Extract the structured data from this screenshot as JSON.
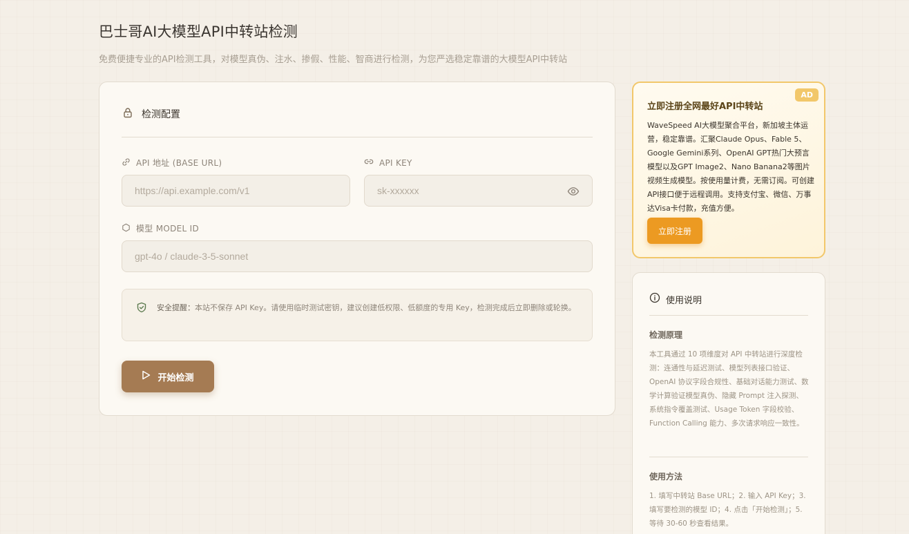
{
  "header": {
    "title": "巴士哥AI大模型API中转站检测",
    "subtitle": "免费便捷专业的API检测工具，对模型真伪、注水、掺假、性能、智商进行检测，为您严选稳定靠谱的大模型API中转站"
  },
  "config": {
    "title": "检测配置",
    "base_url_label": "API 地址 (BASE URL)",
    "base_url_placeholder": "https://api.example.com/v1",
    "api_key_label": "API KEY",
    "api_key_placeholder": "sk-xxxxxx",
    "model_label": "模型 MODEL ID",
    "model_placeholder": "gpt-4o / claude-3-5-sonnet",
    "notice_prefix": "安全提醒：",
    "notice_text": "本站不保存 API Key。请使用临时测试密钥，建议创建低权限、低额度的专用 Key，检测完成后立即删除或轮换。",
    "start_button": "开始检测"
  },
  "ad": {
    "badge": "AD",
    "title": "立即注册全网最好API中转站",
    "description": "WaveSpeed AI大模型聚合平台，新加坡主体运营，稳定靠谱。汇聚Claude Opus、Fable 5、Google Gemini系列、OpenAI GPT热门大预言模型以及GPT Image2、Nano Banana2等图片视频生成模型。按使用量计费，无需订阅。可创建API接口便于远程调用。支持支付宝、微信、万事达Visa卡付款，充值方便。",
    "button": "立即注册"
  },
  "help": {
    "title": "使用说明",
    "principle_title": "检测原理",
    "principle_text": "本工具通过 10 项维度对 API 中转站进行深度检测：连通性与延迟测试、模型列表接口验证、OpenAI 协议字段合规性、基础对话能力测试、数学计算验证模型真伪、隐藏 Prompt 注入探测、系统指令覆盖测试、Usage Token 字段校验、Function Calling 能力、多次请求响应一致性。",
    "usage_title": "使用方法",
    "usage_text": "1. 填写中转站 Base URL；2. 输入 API Key；3. 填写要检测的模型 ID；4. 点击「开始检测」；5. 等待 30-60 秒查看结果。"
  },
  "colors": {
    "accent_brown": "#a57b53",
    "ad_orange": "#ec9a22",
    "ad_border": "#f2c76a"
  }
}
